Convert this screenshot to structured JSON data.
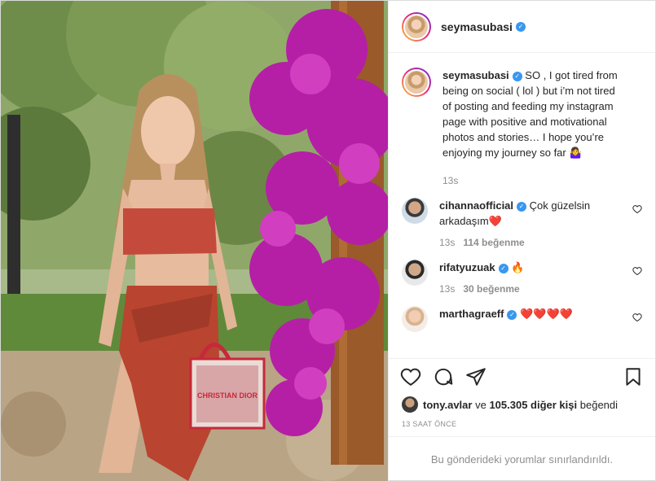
{
  "post": {
    "author": "seymasubasi",
    "verified": true
  },
  "caption": {
    "username": "seymasubasi",
    "text": "SO , I got tired from being on social ( lol ) but i’m not tired of posting and feeding my instagram page with positive and motivational photos and stories… I hope you’re enjoying my journey so far 🤷‍♀️",
    "time": "13s"
  },
  "comments": [
    {
      "username": "cihannaofficial",
      "text": "Çok güzelsin arkadaşım❤️",
      "time": "13s",
      "likes": "114 beğenme"
    },
    {
      "username": "rifatyuzuak",
      "text": "🔥",
      "time": "13s",
      "likes": "30 beğenme"
    },
    {
      "username": "marthagraeff",
      "text": "❤️❤️❤️❤️",
      "time": "",
      "likes": ""
    }
  ],
  "liked_by": {
    "user": "tony.avlar",
    "connector": "ve",
    "others": "105.305 diğer kişi",
    "suffix": "beğendi"
  },
  "timestamp": "13 SAAT ÖNCE",
  "restricted_notice": "Bu gönderideki yorumlar sınırlandırıldı.",
  "photo": {
    "bag_text": "CHRISTIAN DIOR"
  },
  "colors": {
    "verified": "#3897f0",
    "heart": "#ed4956",
    "meta": "#8e8e8e"
  },
  "icons": {
    "like": "heart-outline-icon",
    "comment": "comment-bubble-icon",
    "share": "paper-plane-icon",
    "save": "bookmark-icon",
    "verified": "verified-badge-icon"
  }
}
